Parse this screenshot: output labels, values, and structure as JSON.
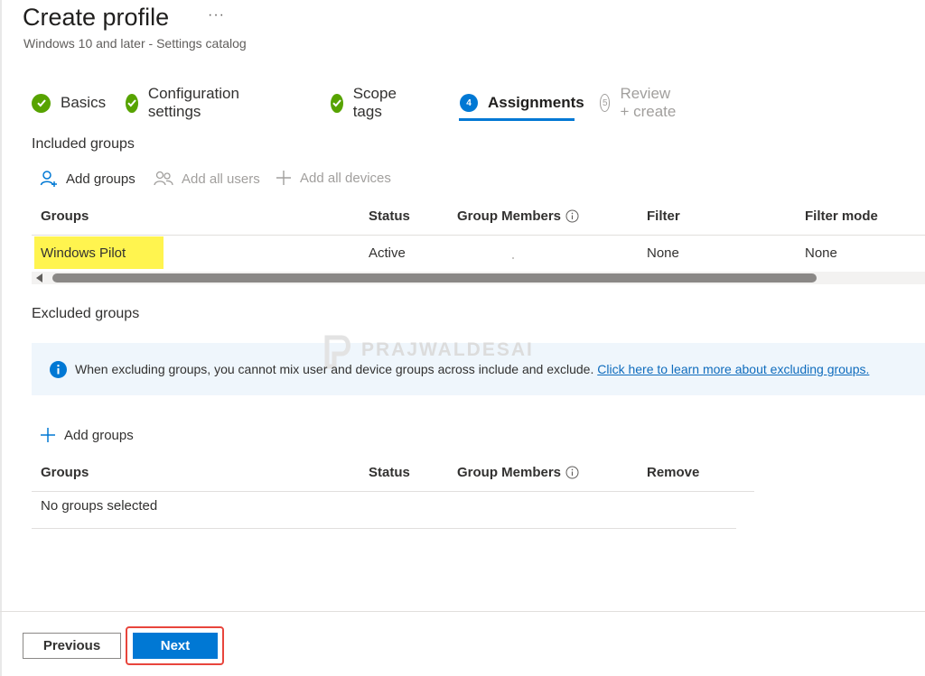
{
  "header": {
    "title": "Create profile",
    "more": "···",
    "subtitle": "Windows 10 and later - Settings catalog"
  },
  "steps": [
    {
      "label": "Basics",
      "state": "done"
    },
    {
      "label": "Configuration settings",
      "state": "done"
    },
    {
      "label": "Scope tags",
      "state": "done"
    },
    {
      "label": "Assignments",
      "state": "current",
      "number": "4"
    },
    {
      "label": "Review + create",
      "state": "todo",
      "number": "5"
    }
  ],
  "included": {
    "title": "Included groups",
    "commands": {
      "add_groups": "Add groups",
      "add_all_users": "Add all users",
      "add_all_devices": "Add all devices"
    },
    "columns": [
      "Groups",
      "Status",
      "Group Members",
      "Filter",
      "Filter mode"
    ],
    "rows": [
      {
        "group": "Windows Pilot",
        "status": "Active",
        "filter": "None",
        "filter_mode": "None"
      }
    ]
  },
  "excluded": {
    "title": "Excluded groups",
    "info_text": "When excluding groups, you cannot mix user and device groups across include and exclude.",
    "info_link": "Click here to learn more about excluding groups.",
    "add_groups": "Add groups",
    "columns": [
      "Groups",
      "Status",
      "Group Members",
      "Remove"
    ],
    "empty_text": "No groups selected"
  },
  "watermark": "PRAJWALDESAI",
  "footer": {
    "previous": "Previous",
    "next": "Next"
  },
  "colors": {
    "accent": "#0078d4",
    "success": "#57a300",
    "highlight": "#fff44f",
    "annotation": "#e8453c"
  }
}
